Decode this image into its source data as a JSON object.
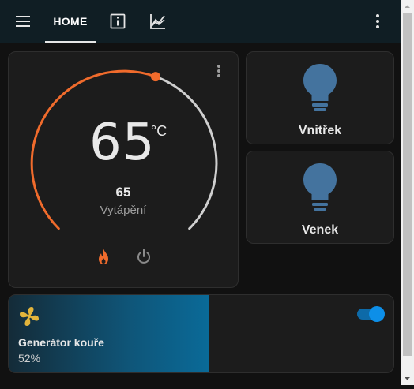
{
  "header": {
    "tabs": [
      {
        "label": "HOME",
        "active": true
      }
    ],
    "icons": [
      "menu-icon",
      "info-icon",
      "history-chart-icon",
      "more-vert-icon"
    ]
  },
  "thermostat": {
    "current_temperature": "65",
    "unit": "°C",
    "target_temperature": "65",
    "mode": "Vytápění",
    "accent_color": "#f06b2c"
  },
  "lights": [
    {
      "name": "Vnitřek",
      "icon": "lightbulb-icon",
      "color": "#44739e"
    },
    {
      "name": "Venek",
      "icon": "lightbulb-icon",
      "color": "#44739e"
    }
  ],
  "fan": {
    "name": "Generátor kouře",
    "percentage": "52%",
    "level": 0.52,
    "icon": "fan-icon",
    "icon_color": "#e2b43b",
    "toggle_on": true,
    "accent_color": "#0d8fe8"
  }
}
